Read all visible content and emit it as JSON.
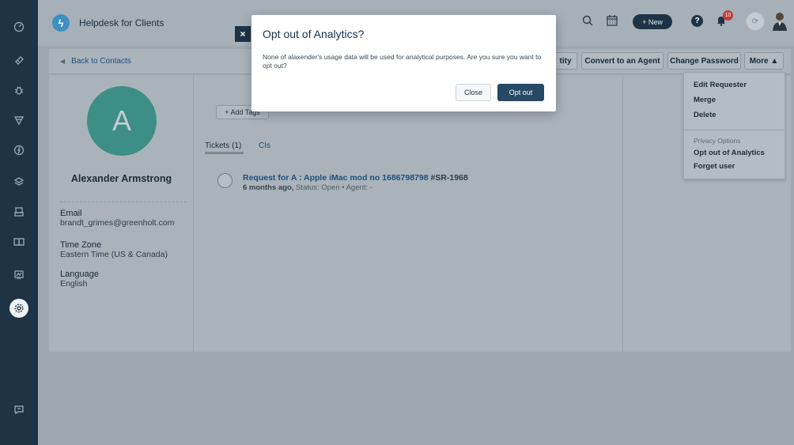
{
  "header": {
    "app_title": "Helpdesk for Clients",
    "new_button": "+ New",
    "help_glyph": "?",
    "notification_count": "10"
  },
  "modal": {
    "close_x": "×",
    "title": "Opt out of Analytics?",
    "body": "None of alaxender's usage data will be used for analytical purposes. Are you sure you want to opt out?",
    "close_button": "Close",
    "confirm_button": "Opt out"
  },
  "subbar": {
    "back_link": "Back to Contacts",
    "partial_button": "tity",
    "convert_button": "Convert to an Agent",
    "change_password_button": "Change Password",
    "more_button": "More ▲"
  },
  "contact": {
    "avatar_letter": "A",
    "name": "Alexander Armstrong",
    "email_label": "Email",
    "email_value": "brandt_grimes@greenholt.com",
    "timezone_label": "Time Zone",
    "timezone_value": "Eastern Time (US & Canada)",
    "language_label": "Language",
    "language_value": "English"
  },
  "tickets": {
    "add_tags": "+ Add Tags",
    "tab_tickets": "Tickets (1)",
    "tab_cis": "CIs",
    "item": {
      "title": "Request for A : Apple iMac mod no 1686798798",
      "number": "#SR-1968",
      "time": "6 months ago,",
      "status": "Status: Open • Agent: -"
    }
  },
  "more_menu": {
    "items": [
      "Edit Requester",
      "Merge",
      "Delete"
    ],
    "section_caption": "Privacy Options",
    "privacy_items": [
      "Opt out of Analytics",
      "Forget user"
    ]
  },
  "sidebar": {
    "icons": [
      "dashboard-icon",
      "tickets-icon",
      "problems-icon",
      "changes-icon",
      "releases-icon",
      "assets-icon",
      "inventory-icon",
      "solutions-icon",
      "reports-icon",
      "admin-icon",
      "chat-icon"
    ]
  }
}
